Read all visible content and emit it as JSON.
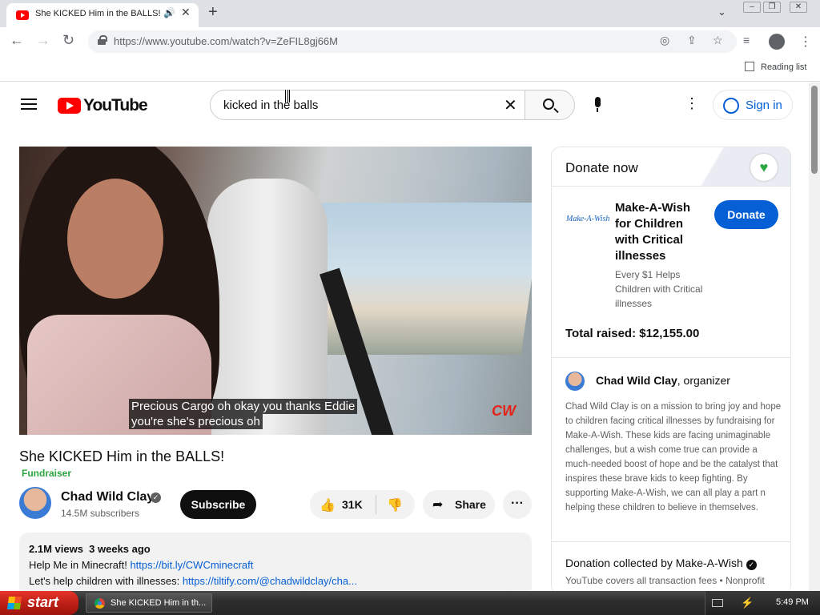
{
  "browser": {
    "tab_title": "She KICKED Him in the BALLS!",
    "url": "https://www.youtube.com/watch?v=ZeFIL8gj66M",
    "reading_list": "Reading list"
  },
  "youtube": {
    "logo_text": "YouTube",
    "search_value": "kicked in the balls",
    "signin_label": "Sign in"
  },
  "video": {
    "caption_line1": "Precious Cargo oh okay you thanks Eddie",
    "caption_line2": "you're she's precious oh",
    "watermark": "CW",
    "title": "She KICKED Him in the BALLS!",
    "badge": "Fundraiser",
    "channel_name": "Chad Wild Clay",
    "subscribers": "14.5M subscribers",
    "subscribe_label": "Subscribe",
    "likes": "31K",
    "share_label": "Share",
    "meta": "2.1M views  3 weeks ago",
    "desc_line1_text": "Help Me in Minecraft! ",
    "desc_line1_link": "https://bit.ly/CWCminecraft",
    "desc_line2_text": "Let's help children with illnesses: ",
    "desc_line2_link": "https://tiltify.com/@chadwildclay/cha..."
  },
  "donate": {
    "header": "Donate now",
    "logo_text": "Make-A-Wish",
    "charity": "Make-A-Wish for Children with Critical illnesses",
    "button": "Donate",
    "tagline": "Every $1 Helps Children with Critical illnesses",
    "raised": "Total raised: $12,155.00",
    "organizer_name": "Chad Wild Clay",
    "organizer_suffix": ", organizer",
    "bio": "Chad Wild Clay is on a mission to bring joy and hope to children facing critical illnesses by fundraising for Make-A-Wish. These kids are facing unimaginable challenges, but a wish come true can provide a much-needed boost of hope and be the catalyst that inspires these brave kids to keep fighting. By supporting Make-A-Wish, we can all play a part n helping these children to believe in themselves.",
    "collected": "Donation collected by Make-A-Wish",
    "fees": "YouTube covers all transaction fees  •  Nonprofit website"
  },
  "taskbar": {
    "start": "start",
    "task_label": "She KICKED Him in th...",
    "clock": "5:49 PM"
  },
  "colors": {
    "youtube_red": "#ff0000",
    "link_blue": "#065fd4",
    "fundraiser_green": "#2ba640"
  }
}
